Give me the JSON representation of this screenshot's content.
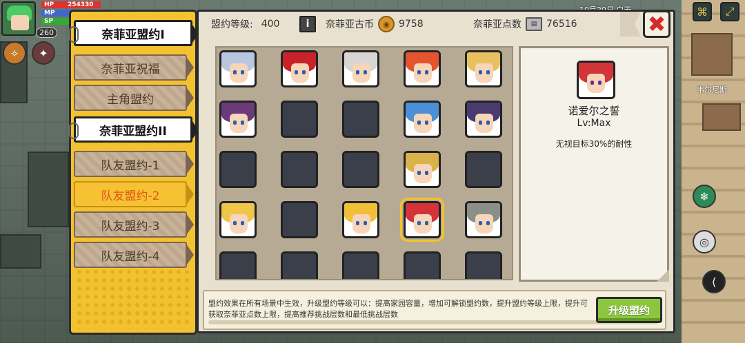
{
  "hud": {
    "hp_label": "HP",
    "hp_value": "254330",
    "mp_label": "MP",
    "sp_label": "SP",
    "level": "260",
    "location": "韦尔尼斯",
    "top_text": "10月29日 白天"
  },
  "tabs": [
    {
      "label": "奈菲亚盟约I",
      "state": "selected"
    },
    {
      "label": "奈菲亚祝福",
      "state": "normal"
    },
    {
      "label": "主角盟约",
      "state": "normal"
    },
    {
      "label": "奈菲亚盟约II",
      "state": "selected"
    },
    {
      "label": "队友盟约-1",
      "state": "normal"
    },
    {
      "label": "队友盟约-2",
      "state": "active"
    },
    {
      "label": "队友盟约-3",
      "state": "normal"
    },
    {
      "label": "队友盟约-4",
      "state": "normal"
    }
  ],
  "header": {
    "level_label": "盟约等级:",
    "level_value": "400",
    "coin_label": "奈菲亚古币",
    "coin_value": "9758",
    "points_label": "奈菲亚点数",
    "points_value": "76516",
    "info_icon": "i",
    "close_icon": "✖"
  },
  "grid": {
    "rows": [
      [
        "silver-blue",
        "red",
        "white",
        "orange-red",
        "blonde"
      ],
      [
        "purple-dark",
        "empty",
        "empty",
        "blue",
        "dark-armored"
      ],
      [
        "empty",
        "empty",
        "empty",
        "blonde-dark",
        "empty"
      ],
      [
        "blonde-girl",
        "empty",
        "blonde-twin",
        "red-selected",
        "gray"
      ],
      [
        "empty",
        "empty",
        "empty",
        "empty",
        "empty"
      ]
    ]
  },
  "detail": {
    "name": "诺爱尔之誓",
    "level": "Lv:Max",
    "effect": "无视目标30%的耐性"
  },
  "footer": {
    "text": "盟约效果在所有场景中生效，升级盟约等级可以：提高家园容量，增加可解锁盟约数，提升盟约等级上限，提升可获取奈菲亚点数上限，提高推荐挑战层数和最低挑战层数",
    "upgrade_label": "升级盟约"
  },
  "colors": {
    "tab_column": "#f2c230",
    "active_tab_text": "#e0571a",
    "upgrade_button": "#8cc63f",
    "close_x": "#d42a2a"
  }
}
